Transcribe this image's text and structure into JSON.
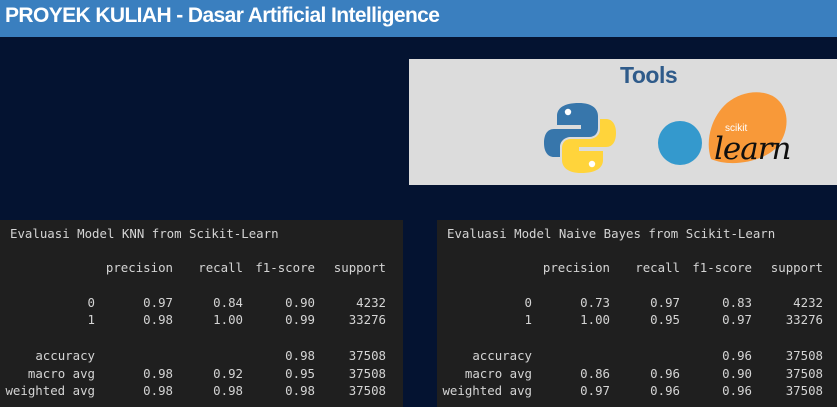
{
  "header": {
    "title": "PROYEK KULIAH - Dasar Artificial Intelligence"
  },
  "tools": {
    "title": "Tools",
    "logos": [
      {
        "name": "python-logo",
        "colors": [
          "#3776ab",
          "#ffd43b"
        ]
      },
      {
        "name": "scikit-learn-logo",
        "small_text": "scikit",
        "big_text": "learn",
        "colors": [
          "#f89939",
          "#3499cd"
        ]
      }
    ]
  },
  "reports": {
    "knn": {
      "title": "Evaluasi Model KNN from Scikit-Learn",
      "headers": [
        "precision",
        "recall",
        "f1-score",
        "support"
      ],
      "rows": [
        [
          "0",
          "0.97",
          "0.84",
          "0.90",
          "4232"
        ],
        [
          "1",
          "0.98",
          "1.00",
          "0.99",
          "33276"
        ],
        [
          "accuracy",
          "",
          "",
          "0.98",
          "37508"
        ],
        [
          "macro avg",
          "0.98",
          "0.92",
          "0.95",
          "37508"
        ],
        [
          "weighted avg",
          "0.98",
          "0.98",
          "0.98",
          "37508"
        ]
      ]
    },
    "nb": {
      "title": "Evaluasi Model Naive Bayes from Scikit-Learn",
      "headers": [
        "precision",
        "recall",
        "f1-score",
        "support"
      ],
      "rows": [
        [
          "0",
          "0.73",
          "0.97",
          "0.83",
          "4232"
        ],
        [
          "1",
          "1.00",
          "0.95",
          "0.97",
          "33276"
        ],
        [
          "accuracy",
          "",
          "",
          "0.96",
          "37508"
        ],
        [
          "macro avg",
          "0.86",
          "0.96",
          "0.90",
          "37508"
        ],
        [
          "weighted avg",
          "0.97",
          "0.96",
          "0.96",
          "37508"
        ]
      ]
    }
  }
}
